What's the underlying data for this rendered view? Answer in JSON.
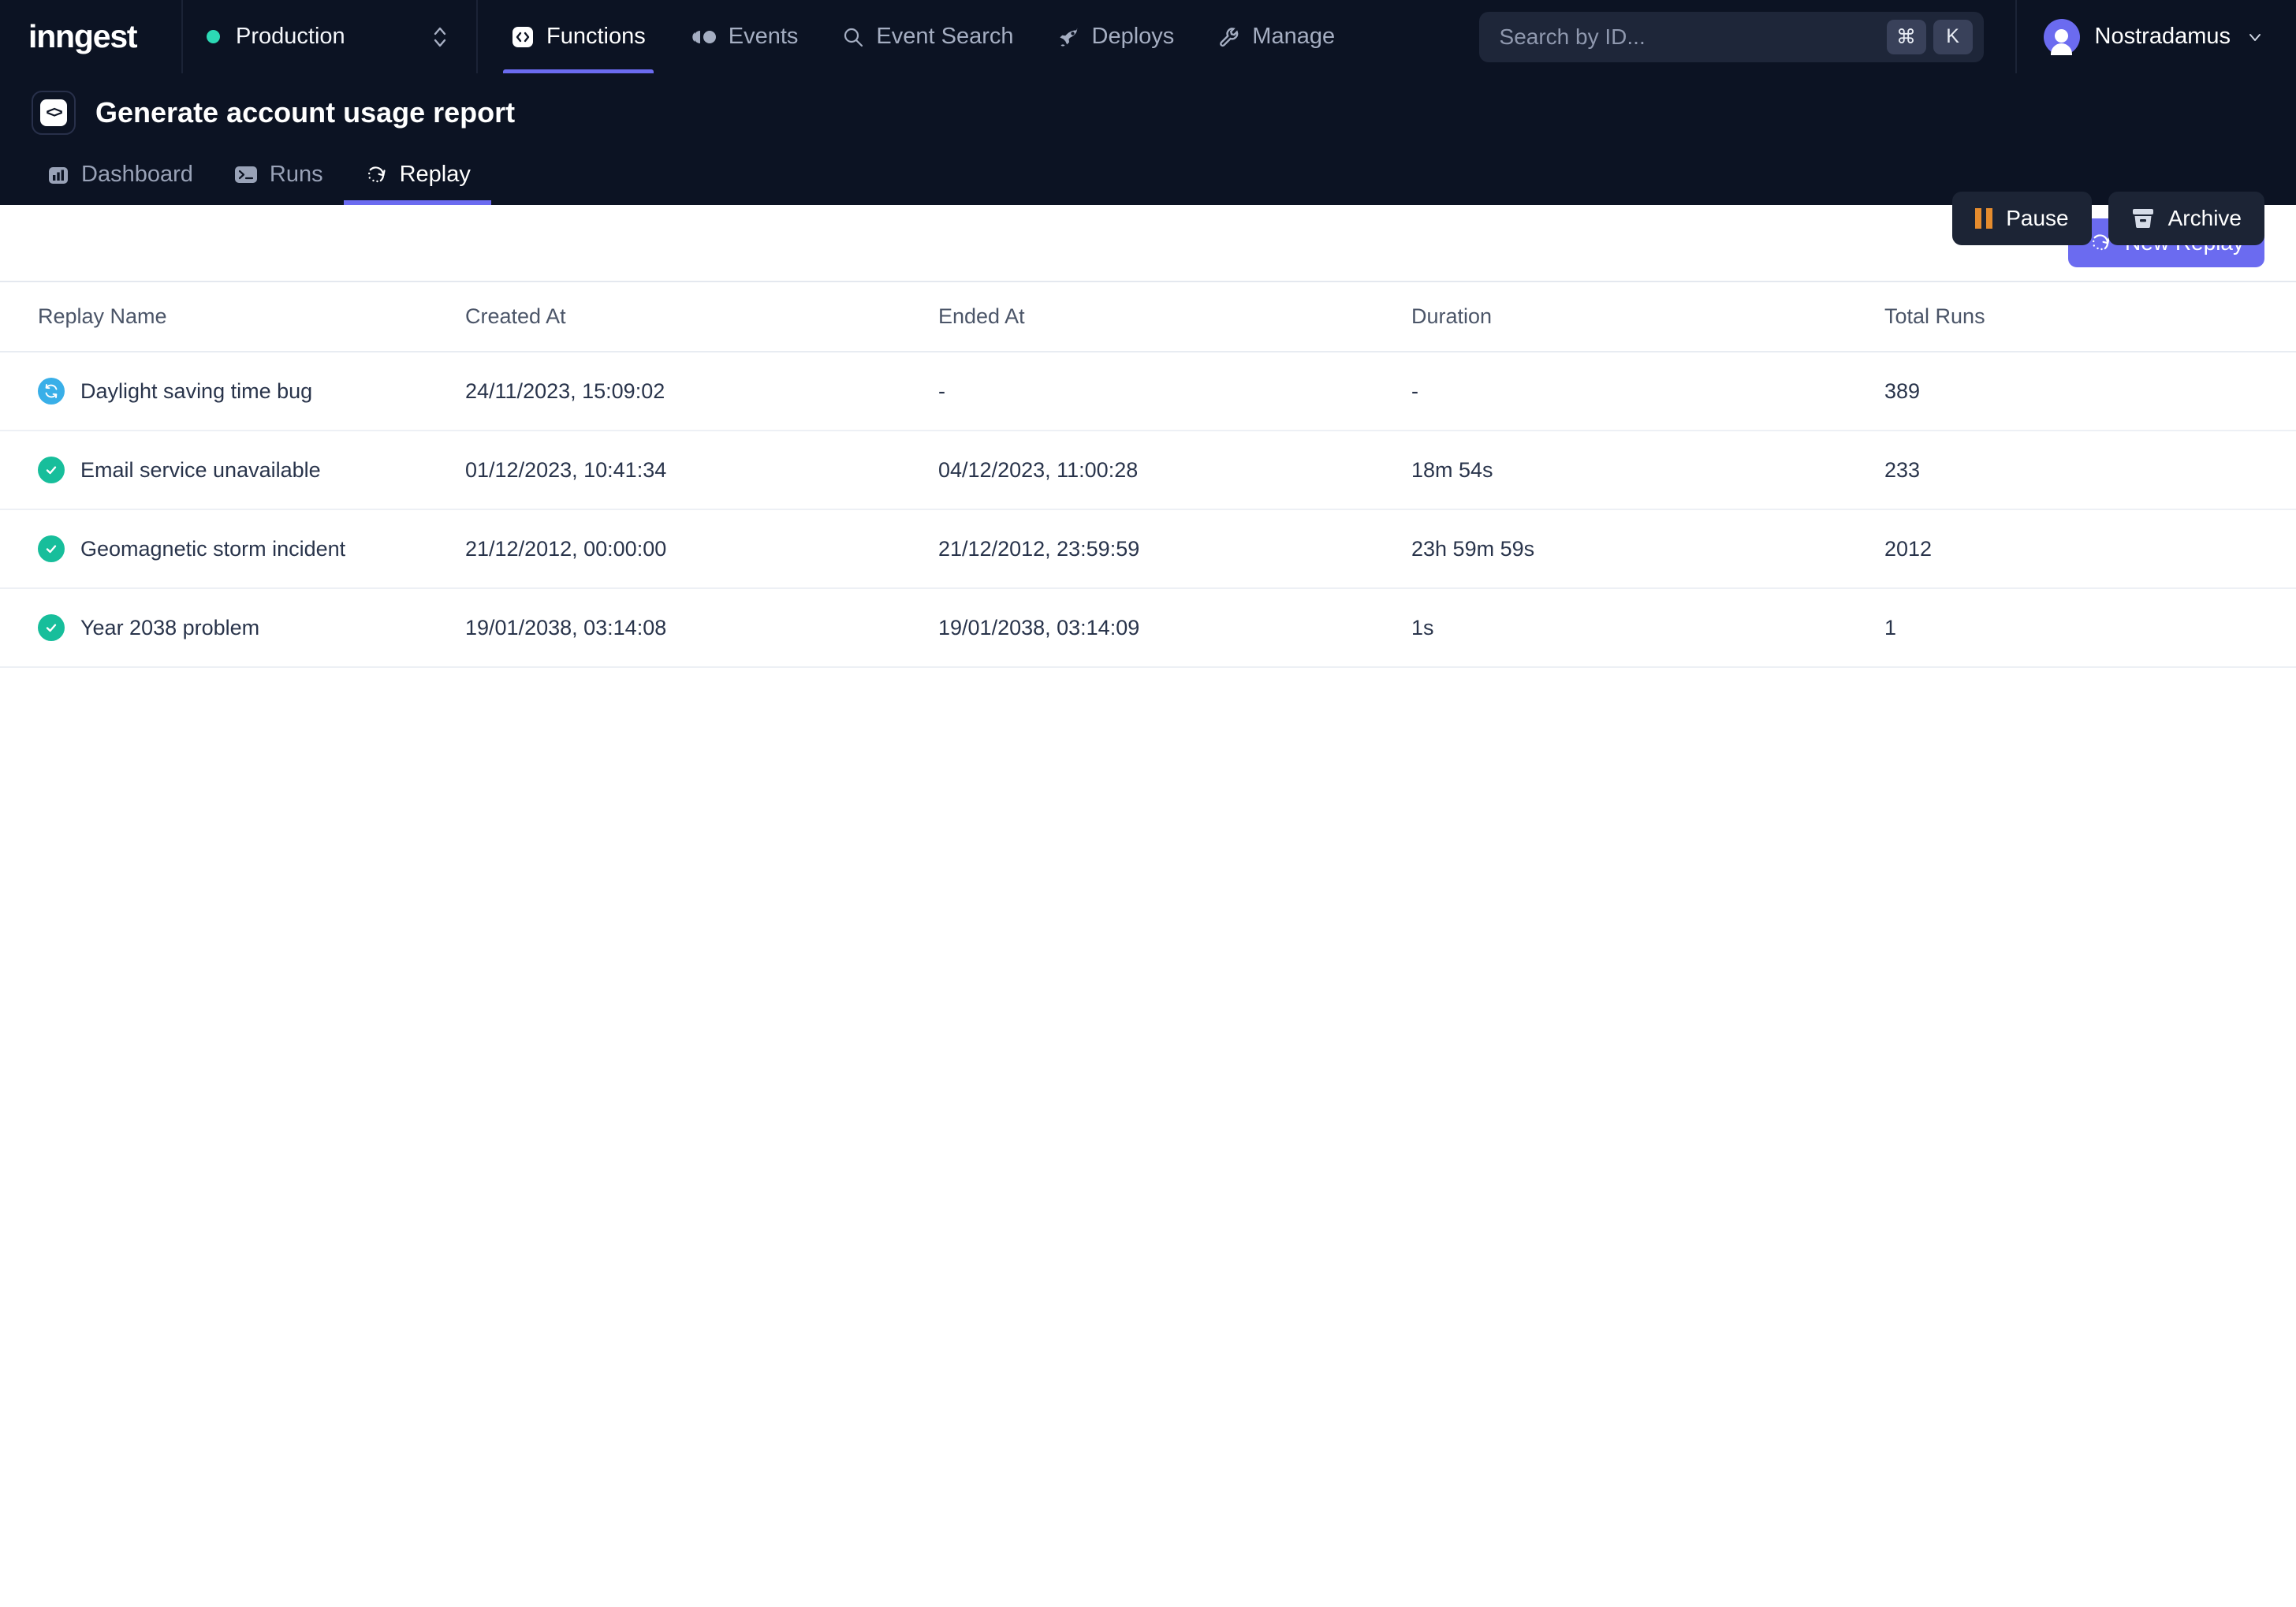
{
  "brand": {
    "logo_text": "inngest",
    "accent": "#6B6BF0"
  },
  "env_selector": {
    "label": "Production",
    "dot_color": "#2CD9B5",
    "icon": "chevron-up-down-icon"
  },
  "top_nav": {
    "items": [
      {
        "label": "Functions",
        "icon": "code-brackets-icon",
        "active": true
      },
      {
        "label": "Events",
        "icon": "events-dots-icon",
        "active": false
      },
      {
        "label": "Event Search",
        "icon": "magnifier-icon",
        "active": false
      },
      {
        "label": "Deploys",
        "icon": "rocket-icon",
        "active": false
      },
      {
        "label": "Manage",
        "icon": "wrench-icon",
        "active": false
      }
    ]
  },
  "search": {
    "placeholder": "Search by ID...",
    "shortcut_modifier": "⌘",
    "shortcut_key": "K"
  },
  "user": {
    "name": "Nostradamus",
    "icon": "avatar-icon",
    "caret": "chevron-down-icon"
  },
  "page_header": {
    "title": "Generate account usage report",
    "icon": "function-code-icon",
    "actions": [
      {
        "label": "Pause",
        "icon": "pause-icon",
        "icon_color": "#E58C2E"
      },
      {
        "label": "Archive",
        "icon": "archive-icon",
        "icon_color": "#D6DCE8"
      }
    ],
    "tabs": [
      {
        "label": "Dashboard",
        "icon": "bar-chart-icon",
        "active": false
      },
      {
        "label": "Runs",
        "icon": "terminal-icon",
        "active": false
      },
      {
        "label": "Replay",
        "icon": "replay-icon",
        "active": true
      }
    ]
  },
  "toolbar": {
    "new_replay_label": "New Replay",
    "new_replay_icon": "replay-icon"
  },
  "table": {
    "columns": [
      "Replay Name",
      "Created At",
      "Ended At",
      "Duration",
      "Total Runs"
    ],
    "rows": [
      {
        "status": "running",
        "status_icon": "refresh-icon",
        "name": "Daylight saving time bug",
        "created_at": "24/11/2023, 15:09:02",
        "ended_at": "-",
        "duration": "-",
        "total_runs": "389"
      },
      {
        "status": "completed",
        "status_icon": "check-circle-icon",
        "name": "Email service unavailable",
        "created_at": "01/12/2023, 10:41:34",
        "ended_at": "04/12/2023, 11:00:28",
        "duration": "18m 54s",
        "total_runs": "233"
      },
      {
        "status": "completed",
        "status_icon": "check-circle-icon",
        "name": "Geomagnetic storm incident",
        "created_at": "21/12/2012, 00:00:00",
        "ended_at": "21/12/2012, 23:59:59",
        "duration": "23h 59m 59s",
        "total_runs": "2012"
      },
      {
        "status": "completed",
        "status_icon": "check-circle-icon",
        "name": "Year 2038 problem",
        "created_at": "19/01/2038, 03:14:08",
        "ended_at": "19/01/2038, 03:14:09",
        "duration": "1s",
        "total_runs": "1"
      }
    ]
  },
  "colors": {
    "nav_background": "#0C1323",
    "status_running": "#39AFE8",
    "status_completed": "#17BE9B",
    "accent_purple": "#6B6BF0"
  }
}
